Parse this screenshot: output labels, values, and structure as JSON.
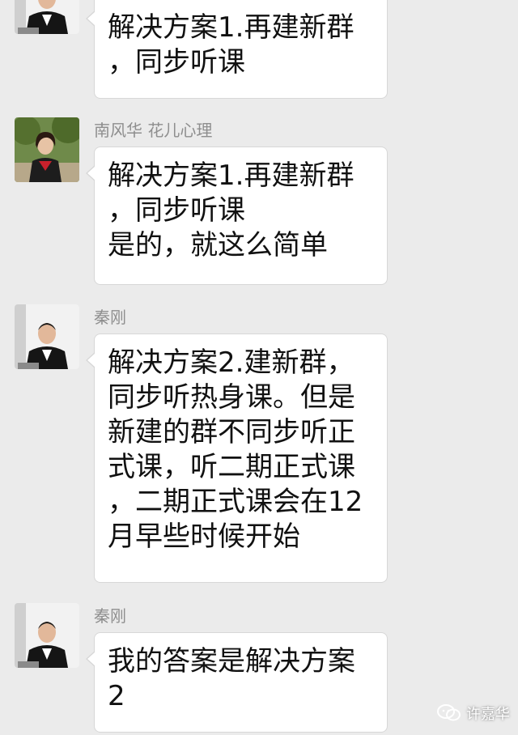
{
  "messages": [
    {
      "sender": "",
      "avatar": "man-in-black-suit-avatar",
      "lines": [
        "解决方案1.再建新群",
        "，同步听课"
      ]
    },
    {
      "sender": "南风华 花儿心理",
      "avatar": "woman-outdoors-avatar",
      "lines": [
        "解决方案1.再建新群",
        "，同步听课",
        "是的，就这么简单"
      ]
    },
    {
      "sender": "秦刚",
      "avatar": "man-in-black-suit-avatar",
      "lines": [
        "解决方案2.建新群，",
        "同步听热身课。但是",
        "新建的群不同步听正",
        "式课，听二期正式课",
        "，二期正式课会在12",
        "月早些时候开始"
      ]
    },
    {
      "sender": "秦刚",
      "avatar": "man-in-black-suit-avatar",
      "lines": [
        "我的答案是解决方案",
        "2"
      ]
    }
  ],
  "watermark": {
    "icon": "wechat-official-account-icon",
    "text": "许嘉华"
  },
  "colors": {
    "background": "#ebebeb",
    "bubble": "#ffffff",
    "bubble_border": "#d7d7d7",
    "sender_text": "#8e8e8e"
  }
}
